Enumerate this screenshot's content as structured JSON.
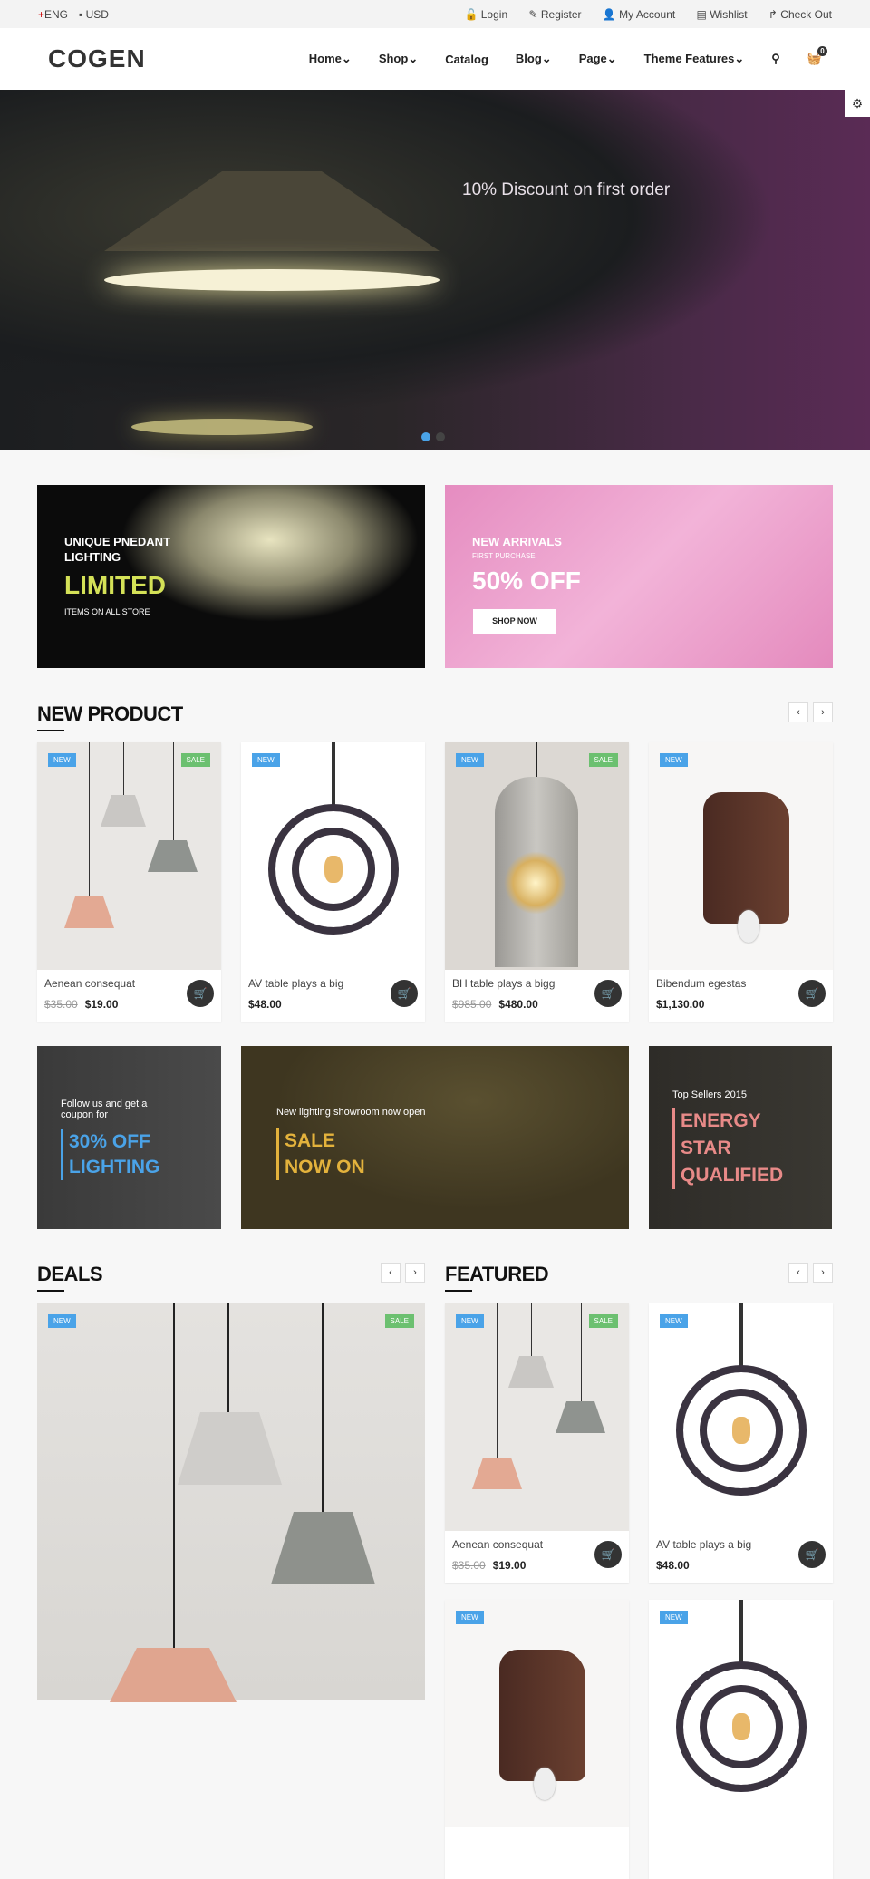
{
  "topbar": {
    "language": "ENG",
    "currency": "USD",
    "links": [
      "Login",
      "Register",
      "My Account",
      "Wishlist",
      "Check Out"
    ]
  },
  "header": {
    "logo": "COGEN",
    "nav": [
      "Home",
      "Shop",
      "Catalog",
      "Blog",
      "Page",
      "Theme Features"
    ],
    "cart_count": "0"
  },
  "hero": {
    "text": "10% Discount on first order",
    "slides": 2,
    "active_slide": 1
  },
  "banners": [
    {
      "line1": "UNIQUE PNEDANT",
      "line2": "LIGHTING",
      "big": "LIMITED",
      "small": "ITEMS ON ALL STORE"
    },
    {
      "line1": "NEW ARRIVALS",
      "sub": "FIRST PURCHASE",
      "big": "50% OFF",
      "button": "SHOP NOW"
    }
  ],
  "new_product": {
    "title": "NEW PRODUCT",
    "items": [
      {
        "name": "Aenean consequat",
        "old": "$35.00",
        "price": "$19.00",
        "new": "NEW",
        "sale": "SALE"
      },
      {
        "name": "AV table plays a big",
        "price": "$48.00",
        "new": "NEW"
      },
      {
        "name": "BH table plays a bigg",
        "old": "$985.00",
        "price": "$480.00",
        "new": "NEW",
        "sale": "SALE"
      },
      {
        "name": "Bibendum egestas",
        "price": "$1,130.00",
        "new": "NEW"
      }
    ]
  },
  "promos": [
    {
      "small": "Follow us and get a coupon for",
      "big1": "30% OFF",
      "big2": "LIGHTING",
      "color": "#4aa3e8"
    },
    {
      "small": "New lighting showroom now open",
      "big1": "SALE",
      "big2": "NOW ON",
      "color": "#e3b23c"
    },
    {
      "small": "Top Sellers 2015",
      "big1": "ENERGY",
      "big2": "STAR",
      "big3": "QUALIFIED",
      "color": "#e88a88"
    }
  ],
  "deals": {
    "title": "DEALS",
    "new": "NEW",
    "sale": "SALE"
  },
  "featured": {
    "title": "FEATURED",
    "items": [
      {
        "name": "Aenean consequat",
        "old": "$35.00",
        "price": "$19.00",
        "new": "NEW",
        "sale": "SALE"
      },
      {
        "name": "AV table plays a big",
        "price": "$48.00",
        "new": "NEW"
      },
      {
        "new": "NEW"
      },
      {
        "new": "NEW"
      }
    ]
  }
}
